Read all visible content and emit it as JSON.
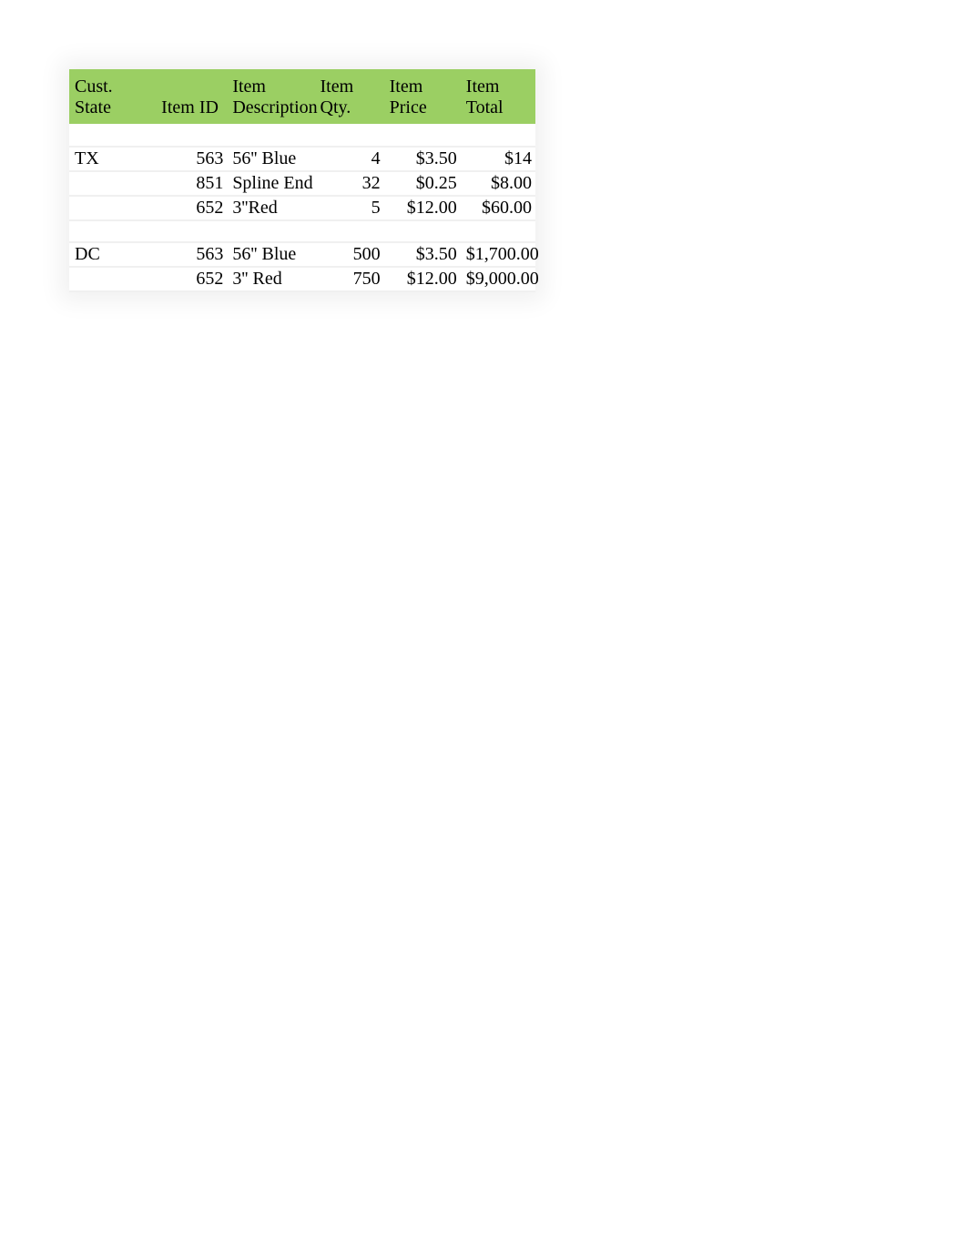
{
  "headers": {
    "state": "Cust. State",
    "item_id": "Item ID",
    "description": "Item Description",
    "qty": "Item Qty.",
    "price": "Item Price",
    "total": "Item Total"
  },
  "rows": [
    {
      "state": "TX",
      "item_id": "563",
      "description": "56'' Blue",
      "qty": "4",
      "price": "$3.50",
      "total": "$14"
    },
    {
      "state": "",
      "item_id": "851",
      "description": "Spline End",
      "qty": "32",
      "price": "$0.25",
      "total": "$8.00"
    },
    {
      "state": "",
      "item_id": "652",
      "description": "3''Red",
      "qty": "5",
      "price": "$12.00",
      "total": "$60.00"
    },
    {
      "spacer": true
    },
    {
      "state": "DC",
      "item_id": "563",
      "description": "56'' Blue",
      "qty": "500",
      "price": "$3.50",
      "total": "$1,700.00"
    },
    {
      "state": "",
      "item_id": "652",
      "description": "3'' Red",
      "qty": "750",
      "price": "$12.00",
      "total": "$9,000.00"
    }
  ],
  "chart_data": {
    "type": "table",
    "columns": [
      "Cust. State",
      "Item ID",
      "Item Description",
      "Item Qty.",
      "Item Price",
      "Item Total"
    ],
    "rows": [
      [
        "TX",
        563,
        "56'' Blue",
        4,
        3.5,
        14.0
      ],
      [
        "TX",
        851,
        "Spline End",
        32,
        0.25,
        8.0
      ],
      [
        "TX",
        652,
        "3''Red",
        5,
        12.0,
        60.0
      ],
      [
        "DC",
        563,
        "56'' Blue",
        500,
        3.5,
        1700.0
      ],
      [
        "DC",
        652,
        "3'' Red",
        750,
        12.0,
        9000.0
      ]
    ]
  }
}
